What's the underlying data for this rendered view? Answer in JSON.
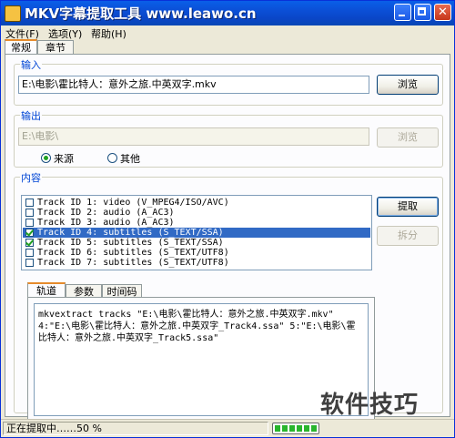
{
  "window": {
    "title": "MKV字幕提取工具 www.leawo.cn",
    "close_glyph": "✕"
  },
  "menu": {
    "items": [
      "文件(F)",
      "选项(Y)",
      "帮助(H)"
    ]
  },
  "main_tabs": [
    {
      "label": "常规",
      "active": true
    },
    {
      "label": "章节",
      "active": false
    }
  ],
  "input_group": {
    "label": "输入",
    "path_value": "E:\\电影\\霍比特人：意外之旅.中英双字.mkv",
    "browse_label": "浏览"
  },
  "output_group": {
    "label": "输出",
    "path_value": "E:\\电影\\",
    "browse_label": "浏览",
    "radio_source": "来源",
    "radio_other": "其他",
    "selected": "来源"
  },
  "content_group": {
    "label": "内容",
    "tracks": [
      {
        "text": "Track ID 1: video (V_MPEG4/ISO/AVC)",
        "checked": false,
        "selected": false
      },
      {
        "text": "Track ID 2: audio (A_AC3)",
        "checked": false,
        "selected": false
      },
      {
        "text": "Track ID 3: audio (A_AC3)",
        "checked": false,
        "selected": false
      },
      {
        "text": "Track ID 4: subtitles (S_TEXT/SSA)",
        "checked": true,
        "selected": true
      },
      {
        "text": "Track ID 5: subtitles (S_TEXT/SSA)",
        "checked": true,
        "selected": false
      },
      {
        "text": "Track ID 6: subtitles (S_TEXT/UTF8)",
        "checked": false,
        "selected": false
      },
      {
        "text": "Track ID 7: subtitles (S_TEXT/UTF8)",
        "checked": false,
        "selected": false
      }
    ],
    "extract_label": "提取",
    "split_label": "拆分"
  },
  "sub_tabs": [
    {
      "label": "轨道",
      "active": true
    },
    {
      "label": "参数",
      "active": false
    },
    {
      "label": "时间码",
      "active": false
    }
  ],
  "command_text": "mkvextract tracks \"E:\\电影\\霍比特人：意外之旅.中英双字.mkv\" 4:\"E:\\电影\\霍比特人：意外之旅.中英双字_Track4.ssa\" 5:\"E:\\电影\\霍比特人：意外之旅.中英双字_Track5.ssa\"",
  "status": {
    "text": "正在提取中……50 %",
    "progress_fraction": 0.5
  },
  "watermark": "软件技巧"
}
